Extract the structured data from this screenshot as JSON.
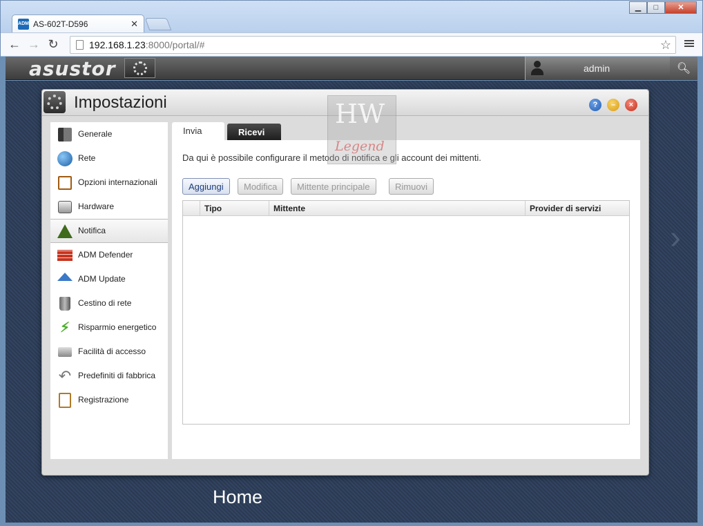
{
  "browser": {
    "tab_title": "AS-602T-D596",
    "url_host": "192.168.1.23",
    "url_rest": ":8000/portal/#"
  },
  "adm": {
    "logo": "asustor",
    "user": "admin"
  },
  "window": {
    "title": "Impostazioni"
  },
  "sidebar": {
    "items": [
      {
        "label": "Generale",
        "icon": "server-icon"
      },
      {
        "label": "Rete",
        "icon": "globe-icon"
      },
      {
        "label": "Opzioni internazionali",
        "icon": "calendar-clock-icon"
      },
      {
        "label": "Hardware",
        "icon": "hard-disk-icon"
      },
      {
        "label": "Notifica",
        "icon": "warning-icon"
      },
      {
        "label": "ADM Defender",
        "icon": "firewall-icon"
      },
      {
        "label": "ADM Update",
        "icon": "upload-arrow-icon"
      },
      {
        "label": "Cestino di rete",
        "icon": "trash-icon"
      },
      {
        "label": "Risparmio energetico",
        "icon": "lightning-icon"
      },
      {
        "label": "Facilità di accesso",
        "icon": "printer-icon"
      },
      {
        "label": "Predefiniti di fabbrica",
        "icon": "undo-icon"
      },
      {
        "label": "Registrazione",
        "icon": "clipboard-icon"
      }
    ],
    "active": "Notifica"
  },
  "content": {
    "tabs": [
      "Invia",
      "Ricevi"
    ],
    "description": "Da qui è possibile configurare il metodo di notifica e gli account dei mittenti.",
    "buttons": {
      "add": "Aggiungi",
      "edit": "Modifica",
      "primary_sender": "Mittente principale",
      "remove": "Rimuovi"
    },
    "table": {
      "columns": [
        "Tipo",
        "Mittente",
        "Provider di servizi"
      ]
    }
  },
  "desktop": {
    "home_label": "Home"
  },
  "watermark": {
    "top": "HW",
    "bottom": "Legend"
  }
}
